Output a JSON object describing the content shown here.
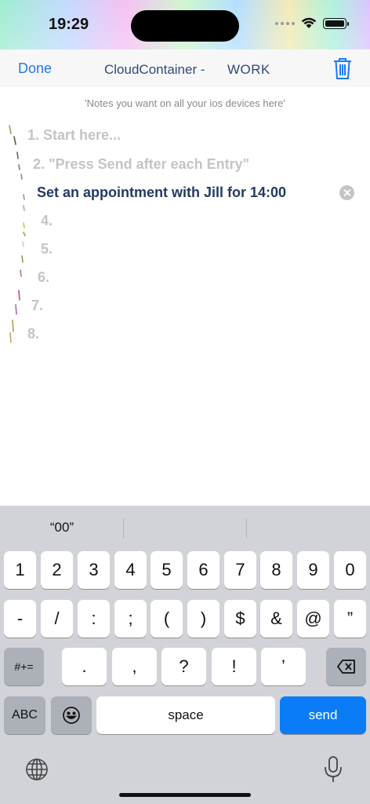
{
  "status": {
    "time": "19:29"
  },
  "nav": {
    "done_label": "Done",
    "title": "CloudContainer -",
    "subtitle": "WORK"
  },
  "hint": "'Notes you want on all your ios devices here'",
  "notes": [
    {
      "text": "1. Start here...",
      "active": false
    },
    {
      "text": "2. \"Press Send after each Entry\"",
      "active": false
    },
    {
      "text": "Set an appointment with Jill for 14:00",
      "active": true
    },
    {
      "text": "4.",
      "active": false
    },
    {
      "text": "5.",
      "active": false
    },
    {
      "text": "6.",
      "active": false
    },
    {
      "text": "7.",
      "active": false
    },
    {
      "text": "8.",
      "active": false
    }
  ],
  "keyboard": {
    "suggestions": [
      "“00”",
      "",
      ""
    ],
    "row1": [
      "1",
      "2",
      "3",
      "4",
      "5",
      "6",
      "7",
      "8",
      "9",
      "0"
    ],
    "row2": [
      "-",
      "/",
      ":",
      ";",
      "(",
      ")",
      "$",
      "&",
      "@",
      "”"
    ],
    "row3": {
      "mode": "#+=",
      "keys": [
        ".",
        ",",
        "?",
        "!",
        "’"
      ]
    },
    "row4": {
      "abc": "ABC",
      "space": "space",
      "send": "send"
    }
  },
  "colors": {
    "accent": "#1a7cf2",
    "send": "#0a7cf7",
    "active_text": "#233a63"
  }
}
